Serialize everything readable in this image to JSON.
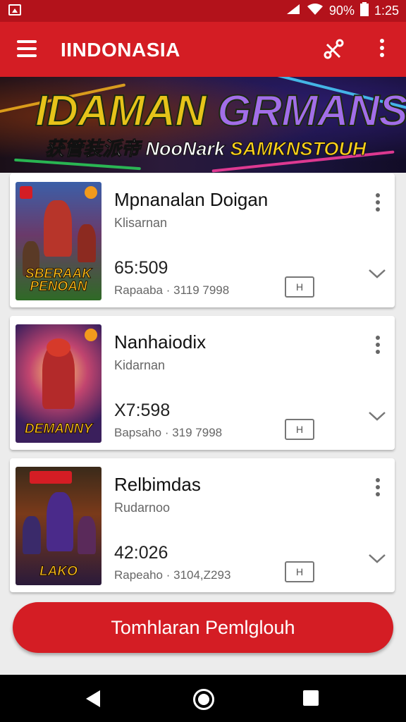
{
  "status_bar": {
    "battery": "90%",
    "time": "1:25"
  },
  "app_bar": {
    "title": "IINDONASIA",
    "menu_icon": "menu-icon",
    "share_icon": "share-icon",
    "more_icon": "more-vert-icon"
  },
  "banner": {
    "title_part1": "IDAMAN",
    "title_part2": "GRMANS",
    "subtitle_white": "获管装派帝 NooNark",
    "subtitle_yellow": "SAMKNSTOUH"
  },
  "items": [
    {
      "title": "Mpnanalan Doigan",
      "subtitle": "Klisarnan",
      "number": "65:509",
      "meta": "Rapaaba · 3119 7998",
      "badge": "H",
      "thumb_text": "SBERAAK PENOAN"
    },
    {
      "title": "Nanhaiodix",
      "subtitle": "Kidarnan",
      "number": "X7:598",
      "meta": "Bapsaho · 319 7998",
      "badge": "H",
      "thumb_text": "DEMANNY"
    },
    {
      "title": "Relbimdas",
      "subtitle": "Rudarnoo",
      "number": "42:026",
      "meta": "Rapeaho · 3104,Z293",
      "badge": "H",
      "thumb_text": "LAKO"
    }
  ],
  "cta": {
    "label": "Tomhlaran Pemlglouh"
  },
  "colors": {
    "primary": "#d41d24",
    "status_bar": "#b3121b"
  }
}
